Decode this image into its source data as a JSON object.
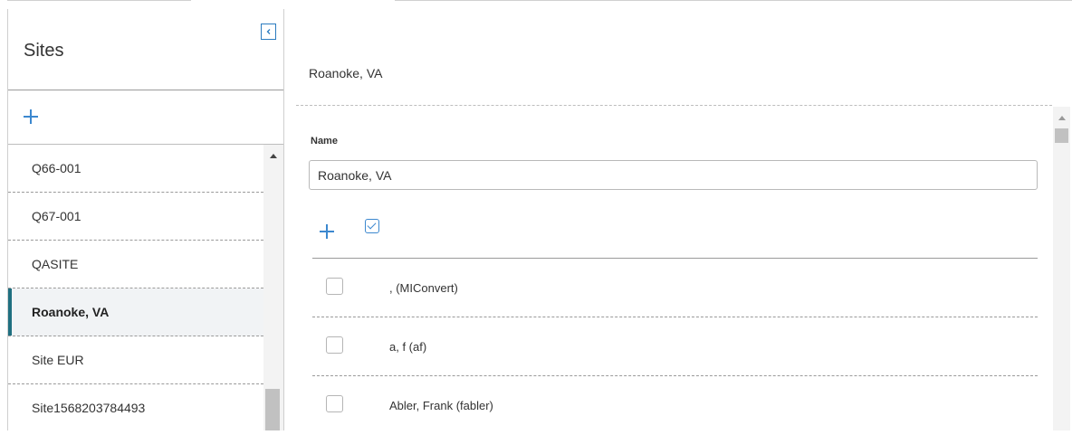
{
  "sites_panel": {
    "title": "Sites",
    "collapse_icon": "chevron-left-icon",
    "add_icon": "plus-icon",
    "items": [
      {
        "label": "Q66-001",
        "selected": false
      },
      {
        "label": "Q67-001",
        "selected": false
      },
      {
        "label": "QASITE",
        "selected": false
      },
      {
        "label": "Roanoke, VA",
        "selected": true
      },
      {
        "label": "Site EUR",
        "selected": false
      },
      {
        "label": "Site1568203784493",
        "selected": false
      }
    ]
  },
  "detail": {
    "title": "Roanoke, VA",
    "name_label": "Name",
    "name_value": "Roanoke, VA",
    "toolbar_icons": [
      "plus-icon",
      "check-square-icon"
    ],
    "users": [
      {
        "label": ", (MIConvert)",
        "checked": false
      },
      {
        "label": "a, f (af)",
        "checked": false
      },
      {
        "label": "Abler, Frank (fabler)",
        "checked": false
      }
    ]
  },
  "colors": {
    "accent": "#3c88cf",
    "selected_marker": "#1f6f80",
    "selected_bg": "#f1f3f5"
  }
}
